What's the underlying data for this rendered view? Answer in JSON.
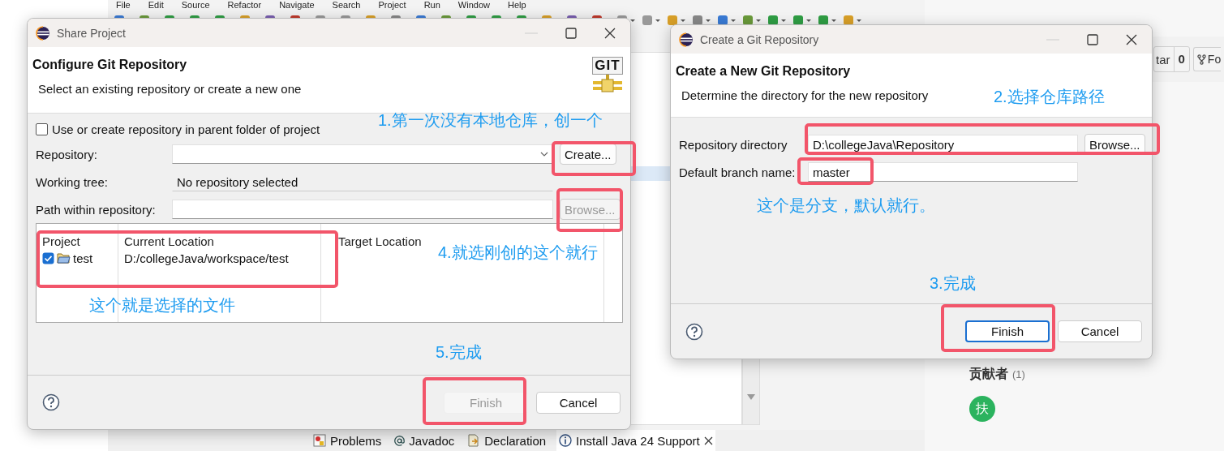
{
  "ide": {
    "menu": [
      "File",
      "Edit",
      "Source",
      "Refactor",
      "Navigate",
      "Search",
      "Project",
      "Run",
      "Window",
      "Help"
    ],
    "bottom_tabs": [
      {
        "label": "Problems",
        "selected": false,
        "closable": false
      },
      {
        "label": "Javadoc",
        "selected": false,
        "closable": false
      },
      {
        "label": "Declaration",
        "selected": false,
        "closable": false
      },
      {
        "label": "Install Java 24 Support",
        "selected": true,
        "closable": true
      }
    ]
  },
  "share_dialog": {
    "title": "Share Project",
    "heading": "Configure Git Repository",
    "description": "Select an existing repository or create a new one",
    "logo": "GIT",
    "parent_folder_option": {
      "label": "Use or create repository in parent folder of project",
      "checked": false
    },
    "fields": [
      {
        "label": "Repository:",
        "kind": "combo",
        "button": {
          "label": "Create...",
          "disabled": false
        }
      },
      {
        "label": "Working tree:",
        "kind": "readonly",
        "value": "No repository selected"
      },
      {
        "label": "Path within repository:",
        "kind": "text",
        "button": {
          "label": "Browse...",
          "disabled": true
        }
      }
    ],
    "table": {
      "columns": [
        "Project",
        "Current Location",
        "Target Location"
      ],
      "rows": [
        {
          "checked": true,
          "cells": [
            "test",
            "D:/collegeJava/workspace/test"
          ]
        }
      ]
    },
    "buttons": [
      {
        "label": "Finish",
        "disabled": true,
        "default": false
      },
      {
        "label": "Cancel",
        "disabled": false,
        "default": false
      }
    ]
  },
  "create_dialog": {
    "title": "Create a Git Repository",
    "heading": "Create a New Git Repository",
    "description": "Determine the directory for the new repository",
    "fields": [
      {
        "label": "Repository directory",
        "kind": "text",
        "value": "D:\\collegeJava\\Repository",
        "button": {
          "label": "Browse...",
          "disabled": false
        }
      },
      {
        "label": "Default branch name:",
        "kind": "text",
        "value": "master"
      }
    ],
    "buttons": [
      {
        "label": "Finish",
        "disabled": false,
        "default": true
      },
      {
        "label": "Cancel",
        "disabled": false,
        "default": false
      }
    ]
  },
  "web_page": {
    "star": {
      "label": "tar",
      "count": "0"
    },
    "fork": {
      "label": "Fo"
    },
    "contributors": {
      "title": "贡献者",
      "count": "(1)",
      "avatars": [
        "扶"
      ]
    }
  },
  "annotations": [
    "2.选择仓库路径",
    "1.第一次没有本地仓库，创一个",
    "这个是分支，默认就行。",
    "4.就选刚创的这个就行",
    "3.完成",
    "这个就是选择的文件",
    "5.完成"
  ]
}
